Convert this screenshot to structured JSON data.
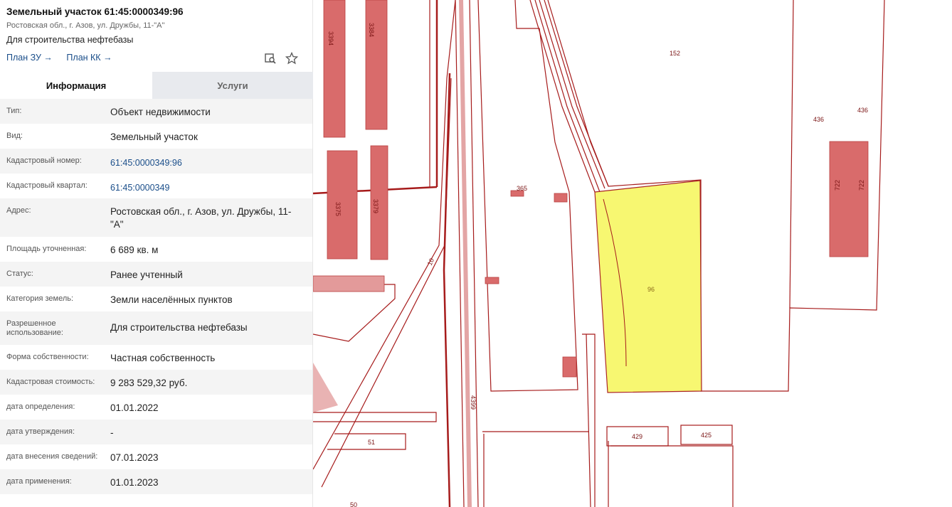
{
  "header": {
    "title": "Земельный участок 61:45:0000349:96",
    "address": "Ростовская обл., г. Азов, ул. Дружбы, 11-\"А\"",
    "purpose": "Для строительства нефтебазы",
    "link_plan_zu": "План ЗУ →",
    "link_plan_kk": "План КК →",
    "icons": [
      "search-doc-icon",
      "star-icon"
    ]
  },
  "tabs": [
    {
      "label": "Информация",
      "active": true
    },
    {
      "label": "Услуги",
      "active": false
    }
  ],
  "info": [
    {
      "label": "Тип:",
      "value": "Объект недвижимости"
    },
    {
      "label": "Вид:",
      "value": "Земельный участок"
    },
    {
      "label": "Кадастровый номер:",
      "value": "61:45:0000349:96"
    },
    {
      "label": "Кадастровый квартал:",
      "value": "61:45:0000349"
    },
    {
      "label": "Адрес:",
      "value": "Ростовская обл., г. Азов, ул. Дружбы, 11-\"А\""
    },
    {
      "label": "Площадь уточненная:",
      "value": "6 689 кв. м"
    },
    {
      "label": "Статус:",
      "value": "Ранее учтенный"
    },
    {
      "label": "Категория земель:",
      "value": "Земли населённых пунктов"
    },
    {
      "label": "Разрешенное использование:",
      "value": "Для строительства нефтебазы"
    },
    {
      "label": "Форма собственности:",
      "value": "Частная собственность"
    },
    {
      "label": "Кадастровая стоимость:",
      "value": "9 283 529,32 руб."
    },
    {
      "label": "дата определения:",
      "value": "01.01.2022"
    },
    {
      "label": "дата утверждения:",
      "value": "-"
    },
    {
      "label": "дата внесения сведений:",
      "value": "07.01.2023"
    },
    {
      "label": "дата применения:",
      "value": "01.01.2023"
    }
  ],
  "map": {
    "labels": {
      "p3394": "3394",
      "p3384": "3384",
      "p3375": "3375",
      "p3379": "3379",
      "p152": "152",
      "p436a": "436",
      "p436b": "436",
      "p365": "365",
      "p96": "96",
      "p722a": "722",
      "p722b": "722",
      "p10": "10",
      "p4399": "4399",
      "p429": "429",
      "p425": "425",
      "p51": "51",
      "p50": "50"
    },
    "colors": {
      "boundary": "#a61b1b",
      "building": "#d96b6b",
      "selected": "#f7f76a"
    }
  }
}
